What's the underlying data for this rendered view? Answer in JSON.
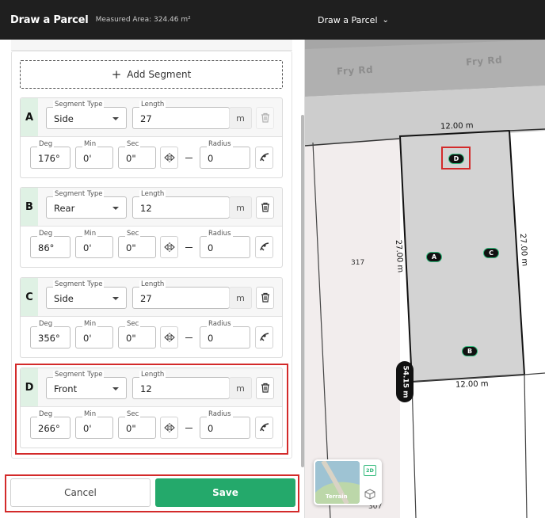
{
  "header": {
    "title": "Draw a Parcel",
    "measured_area": "Measured Area: 324.46 m²"
  },
  "map_header": {
    "title": "Draw a Parcel"
  },
  "add_segment_label": "Add Segment",
  "field_labels": {
    "segment_type": "Segment Type",
    "length": "Length",
    "deg": "Deg",
    "min": "Min",
    "sec": "Sec",
    "radius": "Radius",
    "unit": "m"
  },
  "segments": [
    {
      "letter": "A",
      "type": "Side",
      "length": "27",
      "deg": "176°",
      "min": "0'",
      "sec": "0\"",
      "radius": "0"
    },
    {
      "letter": "B",
      "type": "Rear",
      "length": "12",
      "deg": "86°",
      "min": "0'",
      "sec": "0\"",
      "radius": "0"
    },
    {
      "letter": "C",
      "type": "Side",
      "length": "27",
      "deg": "356°",
      "min": "0'",
      "sec": "0\"",
      "radius": "0"
    },
    {
      "letter": "D",
      "type": "Front",
      "length": "12",
      "deg": "266°",
      "min": "0'",
      "sec": "0\"",
      "radius": "0"
    }
  ],
  "footer": {
    "cancel_label": "Cancel",
    "save_label": "Save"
  },
  "map": {
    "road_names": [
      "Fry Rd",
      "Fry Rd"
    ],
    "dimensions": {
      "top": "12.00 m",
      "bottom": "12.00 m",
      "left": "27.00 m",
      "right": "27.00 m",
      "front": "54.15 m"
    },
    "markers": [
      "D",
      "A",
      "C",
      "B"
    ],
    "lot_numbers": [
      "317",
      "307"
    ],
    "terrain_label": "Terrain",
    "mode_2d": "2D",
    "colors": {
      "accent": "#24a96b",
      "highlight": "#d32a2a",
      "parcel_fill": "#d2d2d2",
      "road": "#cfcfcf"
    }
  }
}
